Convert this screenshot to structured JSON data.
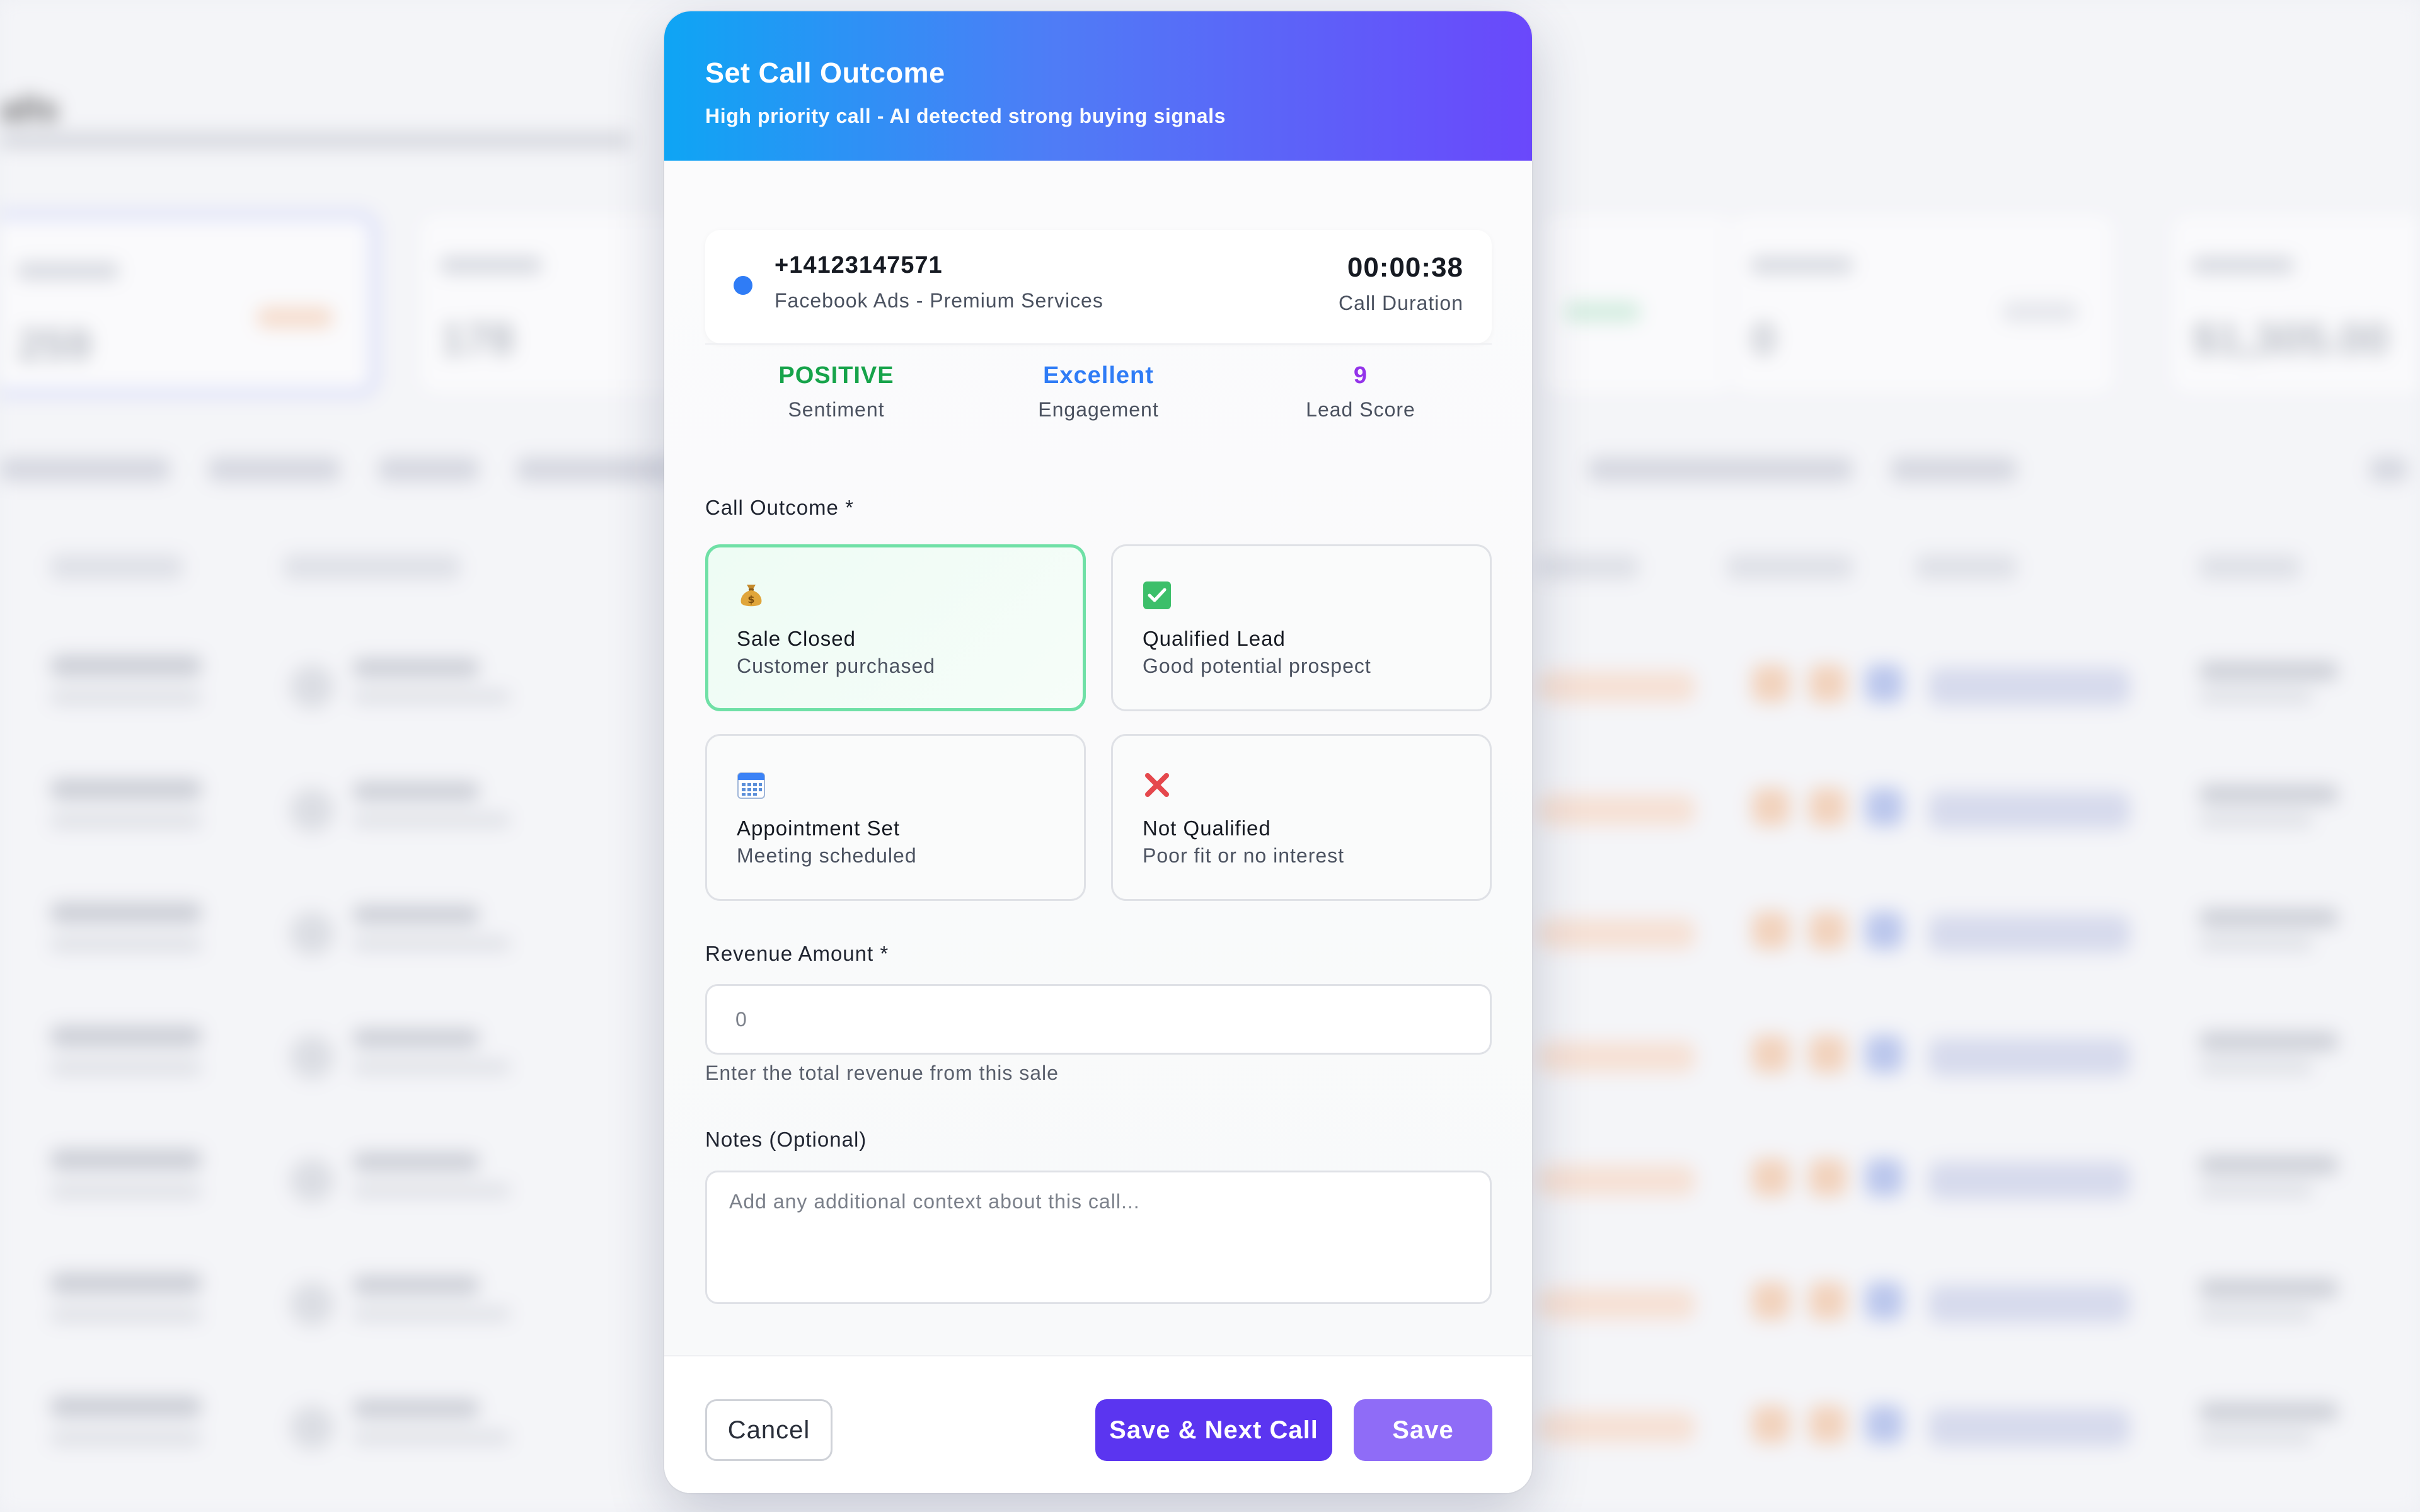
{
  "background": {
    "page_title": "alls",
    "stats": [
      {
        "label": "All Calls",
        "value": "259"
      },
      {
        "label": "Processed",
        "value": "178"
      },
      {
        "label": "Missed",
        "value": "0"
      },
      {
        "label": "Revenue",
        "value": "$1,305.00"
      }
    ]
  },
  "modal": {
    "title": "Set Call Outcome",
    "subtitle": "High priority call - AI detected strong buying signals",
    "call": {
      "phone": "+14123147571",
      "source": "Facebook Ads - Premium Services",
      "duration": "00:00:38",
      "duration_label": "Call Duration"
    },
    "metrics": [
      {
        "value": "POSITIVE",
        "label": "Sentiment",
        "color": "#16a34a"
      },
      {
        "value": "Excellent",
        "label": "Engagement",
        "color": "#2f7cf6"
      },
      {
        "value": "9",
        "label": "Lead Score",
        "color": "#9333ea"
      }
    ],
    "outcome_label": "Call Outcome *",
    "outcomes": [
      {
        "icon": "money-bag-icon",
        "title": "Sale Closed",
        "description": "Customer purchased",
        "selected": true
      },
      {
        "icon": "check-mark-icon",
        "title": "Qualified Lead",
        "description": "Good potential prospect",
        "selected": false
      },
      {
        "icon": "calendar-icon",
        "title": "Appointment Set",
        "description": "Meeting scheduled",
        "selected": false
      },
      {
        "icon": "cross-mark-icon",
        "title": "Not Qualified",
        "description": "Poor fit or no interest",
        "selected": false
      }
    ],
    "revenue": {
      "label": "Revenue Amount *",
      "placeholder": "0",
      "help": "Enter the total revenue from this sale"
    },
    "notes": {
      "label": "Notes (Optional)",
      "placeholder": "Add any additional context about this call..."
    },
    "buttons": {
      "cancel": "Cancel",
      "save_next": "Save & Next Call",
      "save": "Save"
    }
  },
  "colors": {
    "header_start": "#0ea5f4",
    "header_end": "#6a48fb",
    "primary": "#5b35f0",
    "selected_border": "#6fe0a6"
  }
}
